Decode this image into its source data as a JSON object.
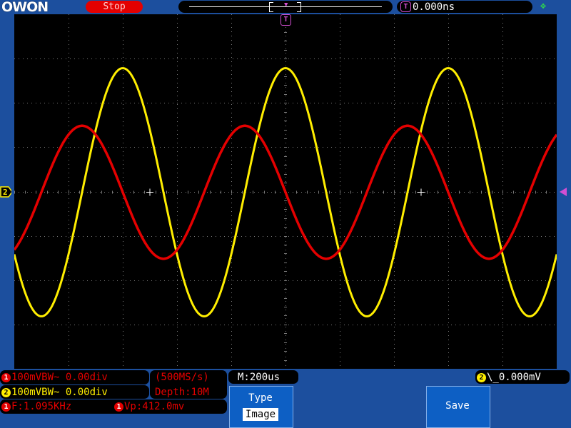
{
  "brand": {
    "logo": "OWON"
  },
  "top_bar": {
    "run_state": "Stop",
    "trigger_time": "0.000ns",
    "trigger_icon": "T",
    "usb_icon": "usb-icon"
  },
  "screen": {
    "trigger_marker": "T",
    "ch2_marker": "2",
    "grid_divisions": {
      "horizontal": 10,
      "vertical": 8
    },
    "colors": {
      "ch1": "#e40000",
      "ch2": "#ffee00",
      "trigger": "#d24fd2",
      "grid": "#7a7a7a"
    }
  },
  "waveforms": {
    "ch1": {
      "color": "#e40000",
      "amplitude_div": 1.5,
      "period_div": 3.0,
      "phase": "cosine-high-at-start-falling"
    },
    "ch2": {
      "color": "#ffee00",
      "amplitude_div": 2.8,
      "period_div": 3.0,
      "phase": "rising-through-center"
    }
  },
  "info": {
    "ch1_line": "100mVBW~ 0.00div",
    "ch2_line": "100mVBW~ 0.00div",
    "ch1_badge": "1",
    "ch2_badge": "2",
    "sample_rate": "(500MS/s)",
    "depth": "Depth:10M",
    "freq": "F:1.095KHz",
    "vp": "Vp:412.0mv",
    "timebase": "M:200us",
    "trigger_level": "0.000mV",
    "trigger_ch": "2"
  },
  "menu": {
    "type_label": "Type",
    "type_value": "Image",
    "save_label": "Save"
  }
}
